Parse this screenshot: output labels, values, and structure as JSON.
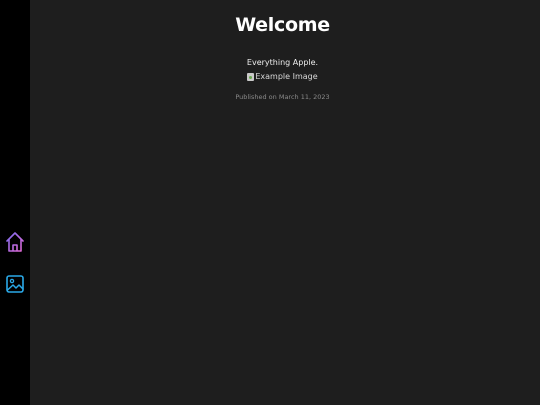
{
  "sidebar": {
    "items": [
      {
        "icon": "home-icon",
        "color_start": "#7c6cf0",
        "color_end": "#e66ad6"
      },
      {
        "icon": "image-gallery-icon",
        "color": "#2aa9e8"
      }
    ]
  },
  "main": {
    "title": "Welcome",
    "tagline": "Everything Apple.",
    "image_alt": "Example Image",
    "published": "Published on March 11, 2023"
  },
  "colors": {
    "background": "#1e1e1e",
    "sidebar": "#000000",
    "text": "#ffffff",
    "muted": "#8a8a8a"
  }
}
